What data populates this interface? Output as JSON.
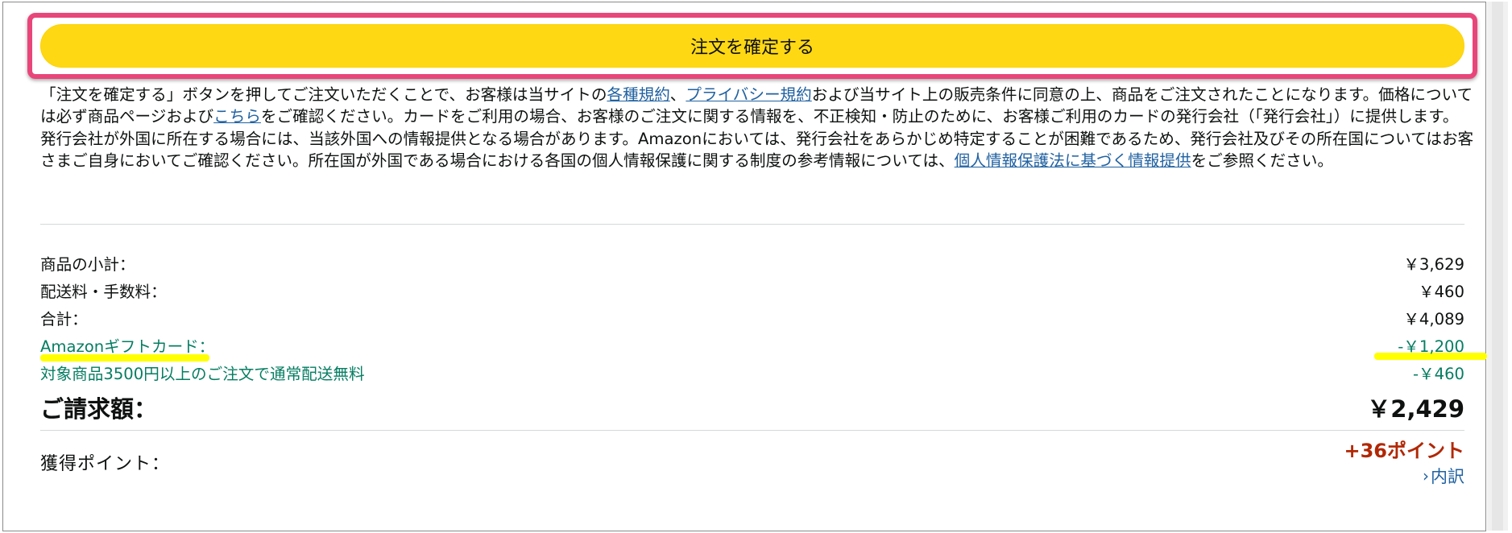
{
  "order": {
    "place_order_label": "注文を確定する"
  },
  "agreement": {
    "part1": "「注文を確定する」ボタンを押してご注文いただくことで、お客様は当サイトの",
    "terms_link": "各種規約",
    "sep1": "、",
    "privacy_link": "プライバシー規約",
    "part2": "および当サイト上の販売条件に同意の上、商品をご注文されたことになります。価格については必ず商品ページおよび",
    "here_link": "こちら",
    "part3": "をご確認ください。カードをご利用の場合、お客様のご注文に関する情報を、不正検知・防止のために、お客様ご利用のカードの発行会社（「発行会社」）に提供します。発行会社が外国に所在する場合には、当該外国への情報提供となる場合があります。Amazonにおいては、発行会社をあらかじめ特定することが困難であるため、発行会社及びその所在国についてはお客さまご自身においてご確認ください。所在国が外国である場合における各国の個人情報保護に関する制度の参考情報については、",
    "privacy_info_link": "個人情報保護法に基づく情報提供",
    "part4": "をご参照ください。"
  },
  "summary": {
    "subtotal_label": "商品の小計：",
    "subtotal_value": "￥3,629",
    "shipping_label": "配送料・手数料：",
    "shipping_value": "￥460",
    "total_label": "合計：",
    "total_value": "￥4,089",
    "gift_card_label": "Amazonギフトカード：",
    "gift_card_value": "-￥1,200",
    "free_shipping_label": "対象商品3500円以上のご注文で通常配送無料",
    "free_shipping_value": "-￥460",
    "billing_label": "ご請求額：",
    "billing_value": "￥2,429"
  },
  "points": {
    "label": "獲得ポイント：",
    "value": "+36ポイント",
    "breakdown_label": "内訳"
  },
  "icons": {
    "chevron": "chevron-right-icon"
  },
  "colors": {
    "button_yellow": "#ffd814",
    "highlight_pink": "#e8467a",
    "marker_yellow": "#ffff00",
    "link_blue": "#2162a1",
    "discount_green": "#067d62",
    "points_red": "#b12704"
  }
}
